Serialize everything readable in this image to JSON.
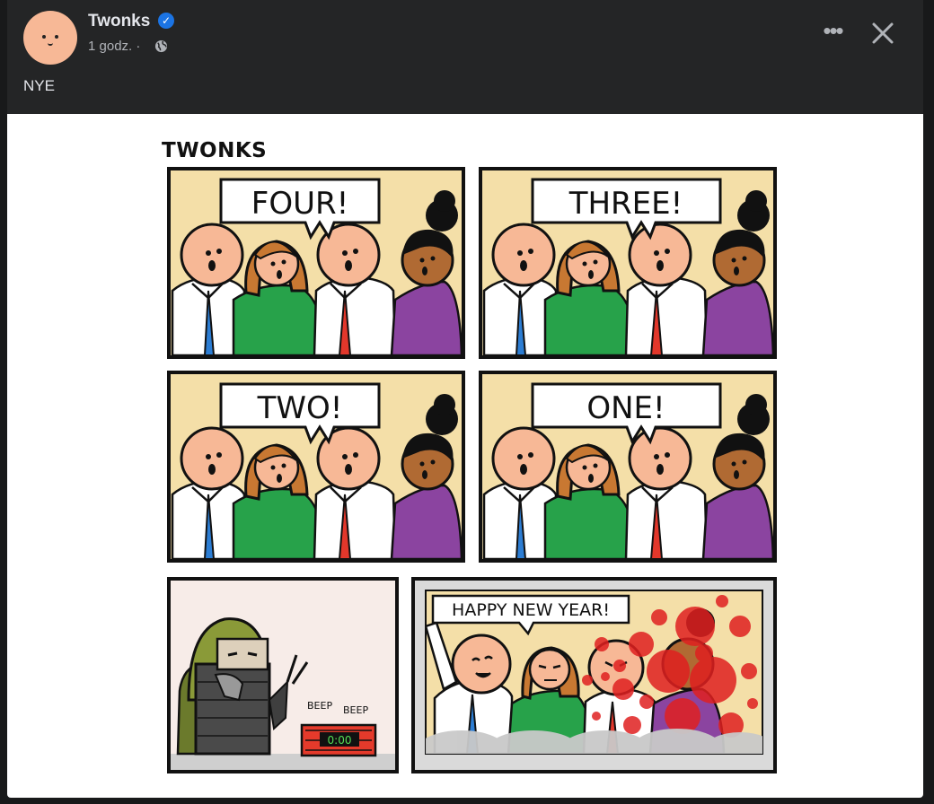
{
  "post": {
    "author": "Twonks",
    "time": "1 godz. ·",
    "text": "NYE"
  },
  "header": {
    "more_label": "•••",
    "verified_mark": "✓"
  },
  "comic": {
    "title": "TWONKS",
    "panels": [
      {
        "speech": "FOUR!"
      },
      {
        "speech": "THREE!"
      },
      {
        "speech": "TWO!"
      },
      {
        "speech": "ONE!"
      }
    ],
    "bomb_sounds": [
      "BEEP",
      "BEEP"
    ],
    "timer_display": "0:00",
    "final_speech": "HAPPY NEW YEAR!"
  },
  "colors": {
    "background": "#242526",
    "text": "#e4e6eb",
    "muted": "#b0b3b8",
    "verified": "#1b74e4",
    "panel_bg": "#f4dfa8",
    "skin": "#f7b896",
    "green_shirt": "#27a24a",
    "purple_shirt": "#8b44a0",
    "blood": "#e02020"
  },
  "icons": {
    "verified": "verified-badge-icon",
    "privacy": "globe-icon",
    "more": "more-options-icon",
    "close": "close-icon"
  }
}
